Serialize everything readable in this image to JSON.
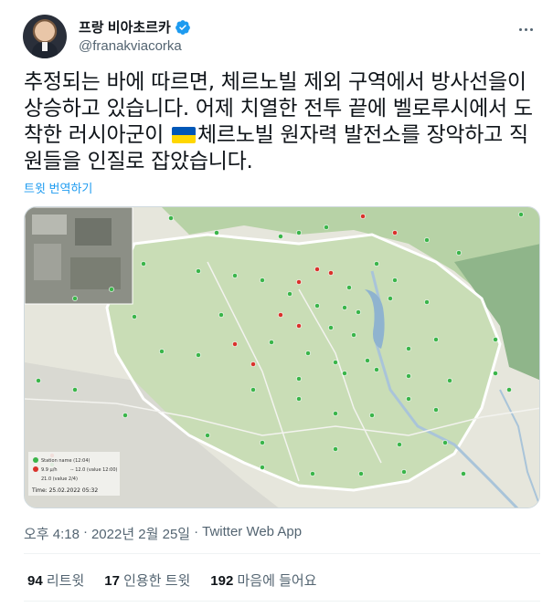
{
  "author": {
    "display_name": "프랑 비아초르카",
    "handle": "@franakviacorka",
    "verified": true
  },
  "tweet": {
    "text_before_flag": "추정되는 바에 따르면, 체르노빌 제외 구역에서 방사선을이 상승하고 있습니다. 어제 치열한 전투 끝에 벨로루시에서 도착한 러시아군이 ",
    "text_after_flag": "체르노빌 원자력 발전소를 장악하고 직원들을 인질로 잡았습니다.",
    "translate_label": "트윗 번역하기"
  },
  "media": {
    "alt": "map",
    "legend_lines": [
      "Station name (12:04)",
      "9.9 μ/h",
      "-- 12.0 (value 12:00)",
      "21.0 (value 2/4)"
    ],
    "timestamp": "Time: 25.02.2022 05:32"
  },
  "meta": {
    "time": "오후 4:18",
    "separator": "·",
    "date": "2022년 2월 25일",
    "app": "Twitter Web App"
  },
  "stats": {
    "retweets_count": "94",
    "retweets_label": "리트윗",
    "quotes_count": "17",
    "quotes_label": "인용한 트윗",
    "likes_count": "192",
    "likes_label": "마음에 들어요"
  },
  "colors": {
    "link": "#1d9bf0",
    "secondary_text": "#536471",
    "marker_green": "#3bb54a",
    "marker_red": "#d9322b"
  }
}
